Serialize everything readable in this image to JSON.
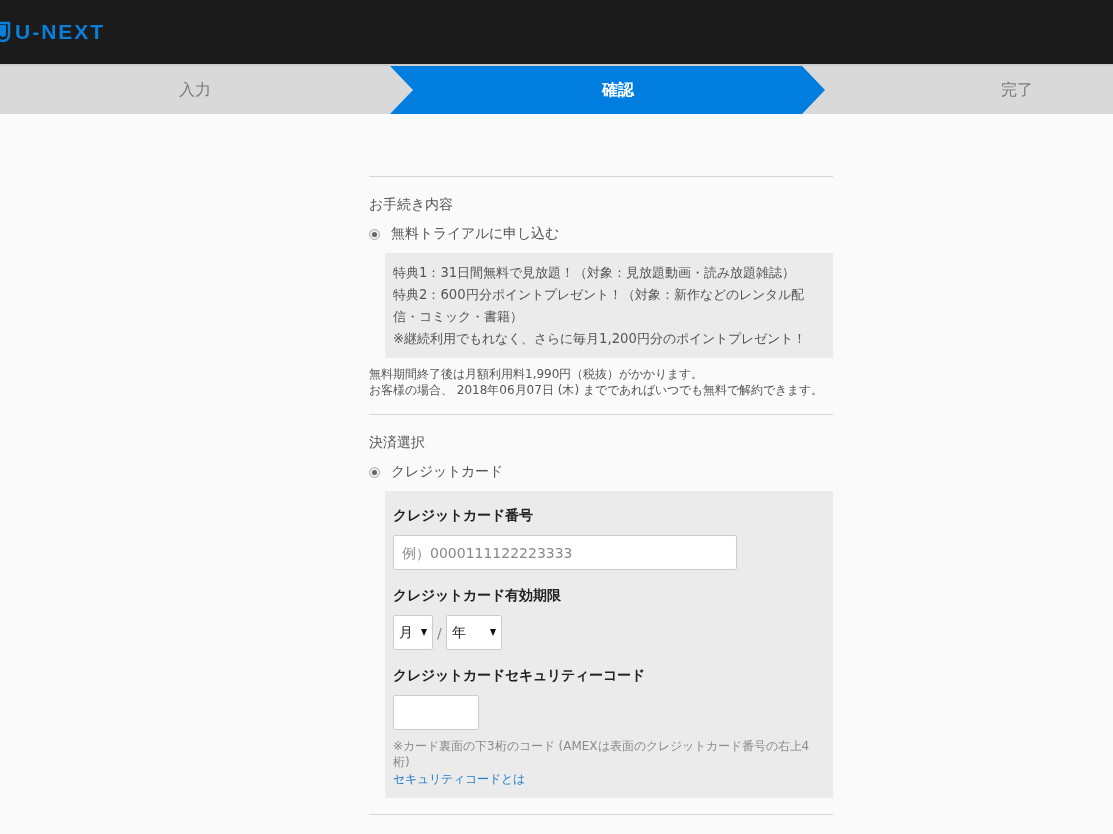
{
  "header": {
    "logo": "U-NEXT"
  },
  "steps": [
    {
      "label": "入力",
      "selected": false
    },
    {
      "label": "確認",
      "selected": true
    },
    {
      "label": "完了",
      "selected": false
    }
  ],
  "plan": {
    "heading": "お手続き内容",
    "option": {
      "label": "無料トライアルに申し込む",
      "selected": true
    },
    "benefits": [
      "特典1：31日間無料で見放題！（対象：見放題動画・読み放題雑誌）",
      "特典2：600円分ポイントプレゼント！（対象：新作などのレンタル配信・コミック・書籍）",
      "※継続利用でもれなく、さらに毎月1,200円分のポイントプレゼント！"
    ],
    "notes": [
      "無料期間終了後は月額利用料1,990円（税抜）がかかります。",
      "お客様の場合、 2018年06月07日 (木) までであればいつでも無料で解約できます。"
    ]
  },
  "payment": {
    "heading": "決済選択",
    "option": {
      "label": "クレジットカード",
      "selected": true
    },
    "card_number": {
      "label": "クレジットカード番号",
      "placeholder": "例）0000111122223333"
    },
    "expiry": {
      "label": "クレジットカード有効期限",
      "month": "月",
      "separator": "/",
      "year": "年"
    },
    "security": {
      "label": "クレジットカードセキュリティーコード",
      "hint": "※カード裏面の下3桁のコード (AMEXは表面のクレジットカード番号の右上4桁)",
      "link": "セキュリティコードとは"
    }
  }
}
